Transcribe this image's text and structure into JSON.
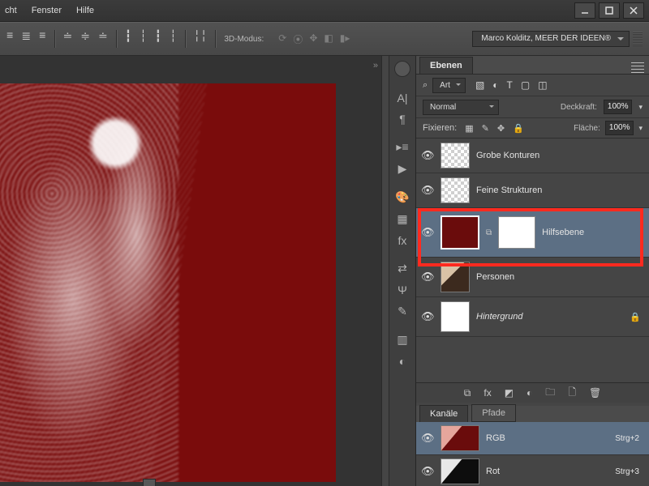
{
  "menu": {
    "items": [
      "cht",
      "Fenster",
      "Hilfe"
    ]
  },
  "optionsbar": {
    "mode3d_label": "3D-Modus:",
    "workspace": "Marco Kolditz, MEER DER IDEEN®"
  },
  "layers_panel": {
    "tab": "Ebenen",
    "filter_kind": "Art",
    "blend_mode": "Normal",
    "opacity_label": "Deckkraft:",
    "opacity_value": "100%",
    "fill_label": "Fläche:",
    "fill_value": "100%",
    "lock_label": "Fixieren:",
    "layers": [
      {
        "name": "Grobe Konturen"
      },
      {
        "name": "Feine Strukturen"
      },
      {
        "name": "Hilfsebene"
      },
      {
        "name": "Personen"
      },
      {
        "name": "Hintergrund"
      }
    ],
    "footer_fx": "fx"
  },
  "channels_panel": {
    "tab_channels": "Kanäle",
    "tab_paths": "Pfade",
    "channels": [
      {
        "name": "RGB",
        "shortcut": "Strg+2"
      },
      {
        "name": "Rot",
        "shortcut": "Strg+3"
      }
    ]
  },
  "filter_label_prefix": "⌕"
}
